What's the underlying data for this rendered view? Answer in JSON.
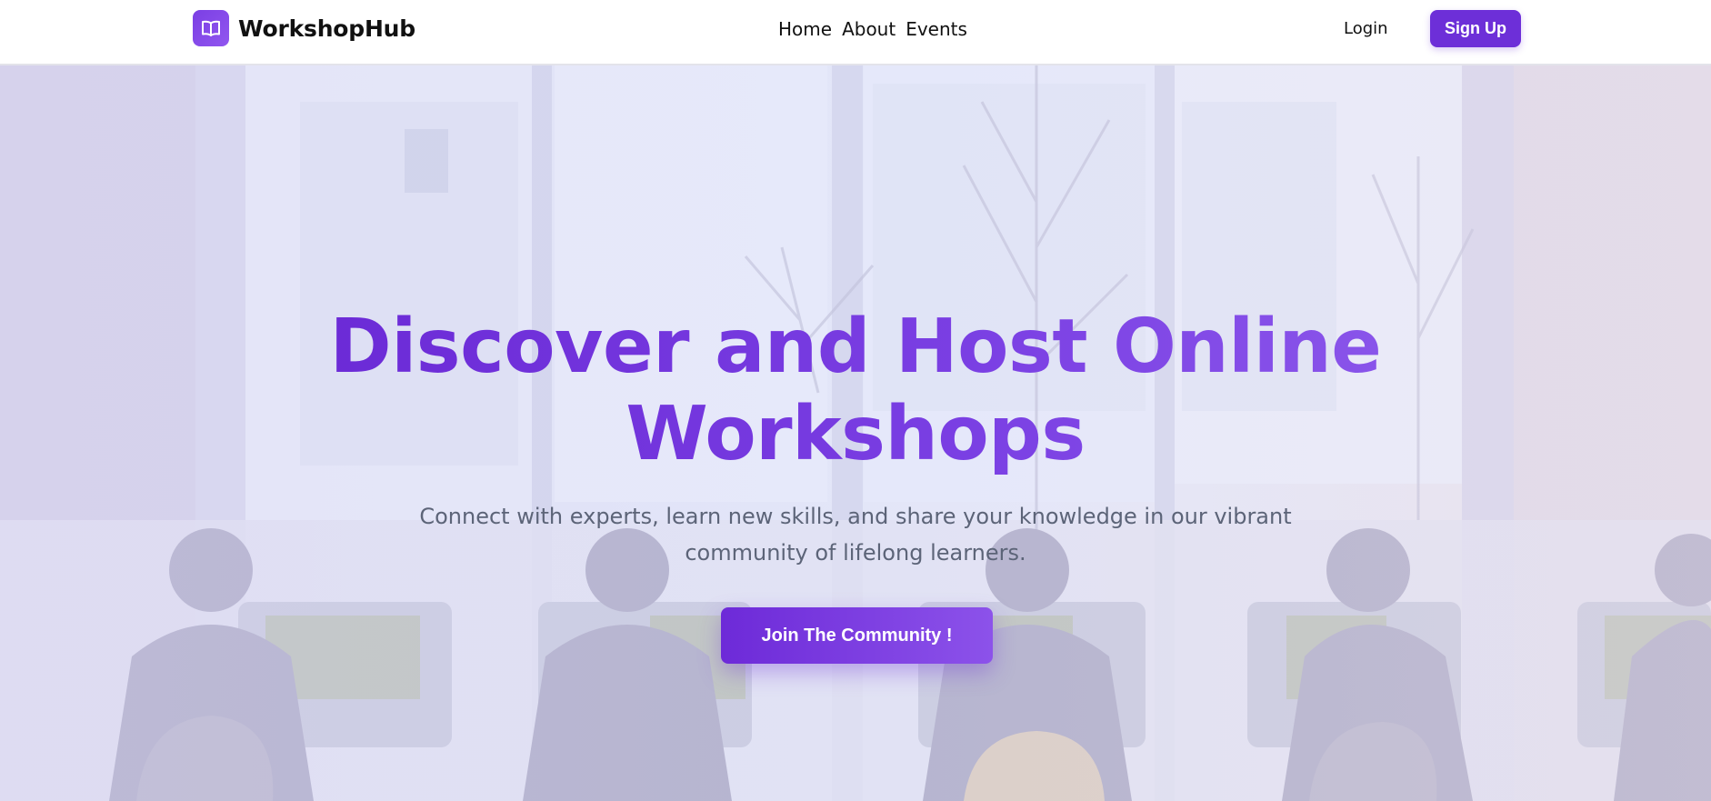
{
  "brand": {
    "name": "WorkshopHub",
    "logo_icon": "open-book-icon"
  },
  "nav": {
    "links": [
      "Home",
      "About",
      "Events"
    ]
  },
  "auth": {
    "login_label": "Login",
    "signup_label": "Sign Up"
  },
  "hero": {
    "title_line1": "Discover and Host Online",
    "title_line2": "Workshops",
    "subtitle": "Connect with experts, learn new skills, and share your knowledge in our vibrant community of lifelong learners.",
    "cta_label": "Join The Community !"
  },
  "colors": {
    "accent": "#6d2fd8",
    "accent_light": "#8c52ea",
    "subtitle_text": "#5c6478",
    "hero_bg": "#dfe2f6"
  }
}
